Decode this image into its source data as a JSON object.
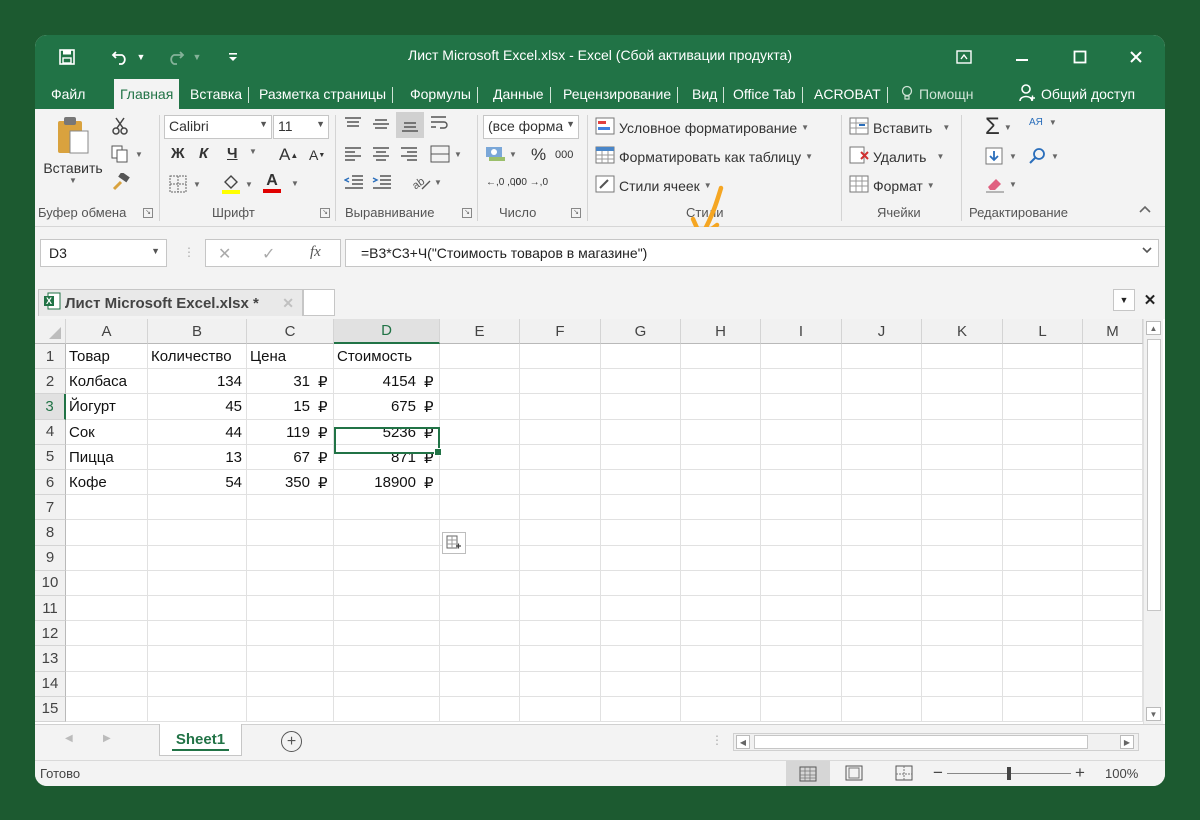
{
  "title": "Лист Microsoft Excel.xlsx - Excel (Сбой активации продукта)",
  "ribbon_tabs": [
    "Файл",
    "Главная",
    "Вставка",
    "Разметка страницы",
    "Формулы",
    "Данные",
    "Рецензирование",
    "Вид",
    "Office Tab",
    "ACROBAT"
  ],
  "help_label": "Помощн",
  "share_label": "Общий доступ",
  "clipboard": {
    "paste_label": "Вставить",
    "group_label": "Буфер обмена"
  },
  "font": {
    "name": "Calibri",
    "size": "11",
    "bold": "Ж",
    "italic": "К",
    "underline": "Ч",
    "grow": "A",
    "shrink": "A",
    "font_color_letter": "A",
    "group_label": "Шрифт"
  },
  "alignment": {
    "group_label": "Выравнивание"
  },
  "number": {
    "format": "(все форма",
    "percent": "%",
    "thousands": "000",
    "inc_decimal": "←,0 ,00",
    "dec_decimal": ",00 →,0",
    "group_label": "Число"
  },
  "styles": {
    "conditional": "Условное форматирование",
    "as_table": "Форматировать как таблицу",
    "cell_styles": "Стили ячеек",
    "group_label": "Стили"
  },
  "cells_group": {
    "insert": "Вставить",
    "delete": "Удалить",
    "format": "Формат",
    "group_label": "Ячейки"
  },
  "editing": {
    "sum": "Σ",
    "sort": "АЯ",
    "group_label": "Редактирование"
  },
  "formula_bar": {
    "name_box": "D3",
    "formula": "=B3*C3+Ч(\"Стоимость товаров в магазине\")",
    "fx": "fx",
    "cancel": "✕",
    "enter": "✓"
  },
  "doc_tab": {
    "label": "Лист Microsoft Excel.xlsx *"
  },
  "columns": [
    "A",
    "B",
    "C",
    "D",
    "E",
    "F",
    "G",
    "H",
    "I",
    "J",
    "K",
    "L",
    "M"
  ],
  "rows": [
    "1",
    "2",
    "3",
    "4",
    "5",
    "6",
    "7",
    "8",
    "9",
    "10",
    "11",
    "12",
    "13",
    "14",
    "15"
  ],
  "table": {
    "header": [
      "Товар",
      "Количество",
      "Цена",
      "Стоимость"
    ],
    "data": [
      [
        "Колбаса",
        "134",
        "31",
        "4154"
      ],
      [
        "Йогурт",
        "45",
        "15",
        "675"
      ],
      [
        "Сок",
        "44",
        "119",
        "5236"
      ],
      [
        "Пицца",
        "13",
        "67",
        "871"
      ],
      [
        "Кофе",
        "54",
        "350",
        "18900"
      ]
    ],
    "currency": "₽"
  },
  "sheet_tab": "Sheet1",
  "status": {
    "ready": "Готово",
    "zoom": "100%",
    "zoom_fraction": 0.5
  },
  "colors": {
    "excel_green": "#217346",
    "background": "#1c5a30",
    "annotation_arrow": "#f5a623"
  }
}
